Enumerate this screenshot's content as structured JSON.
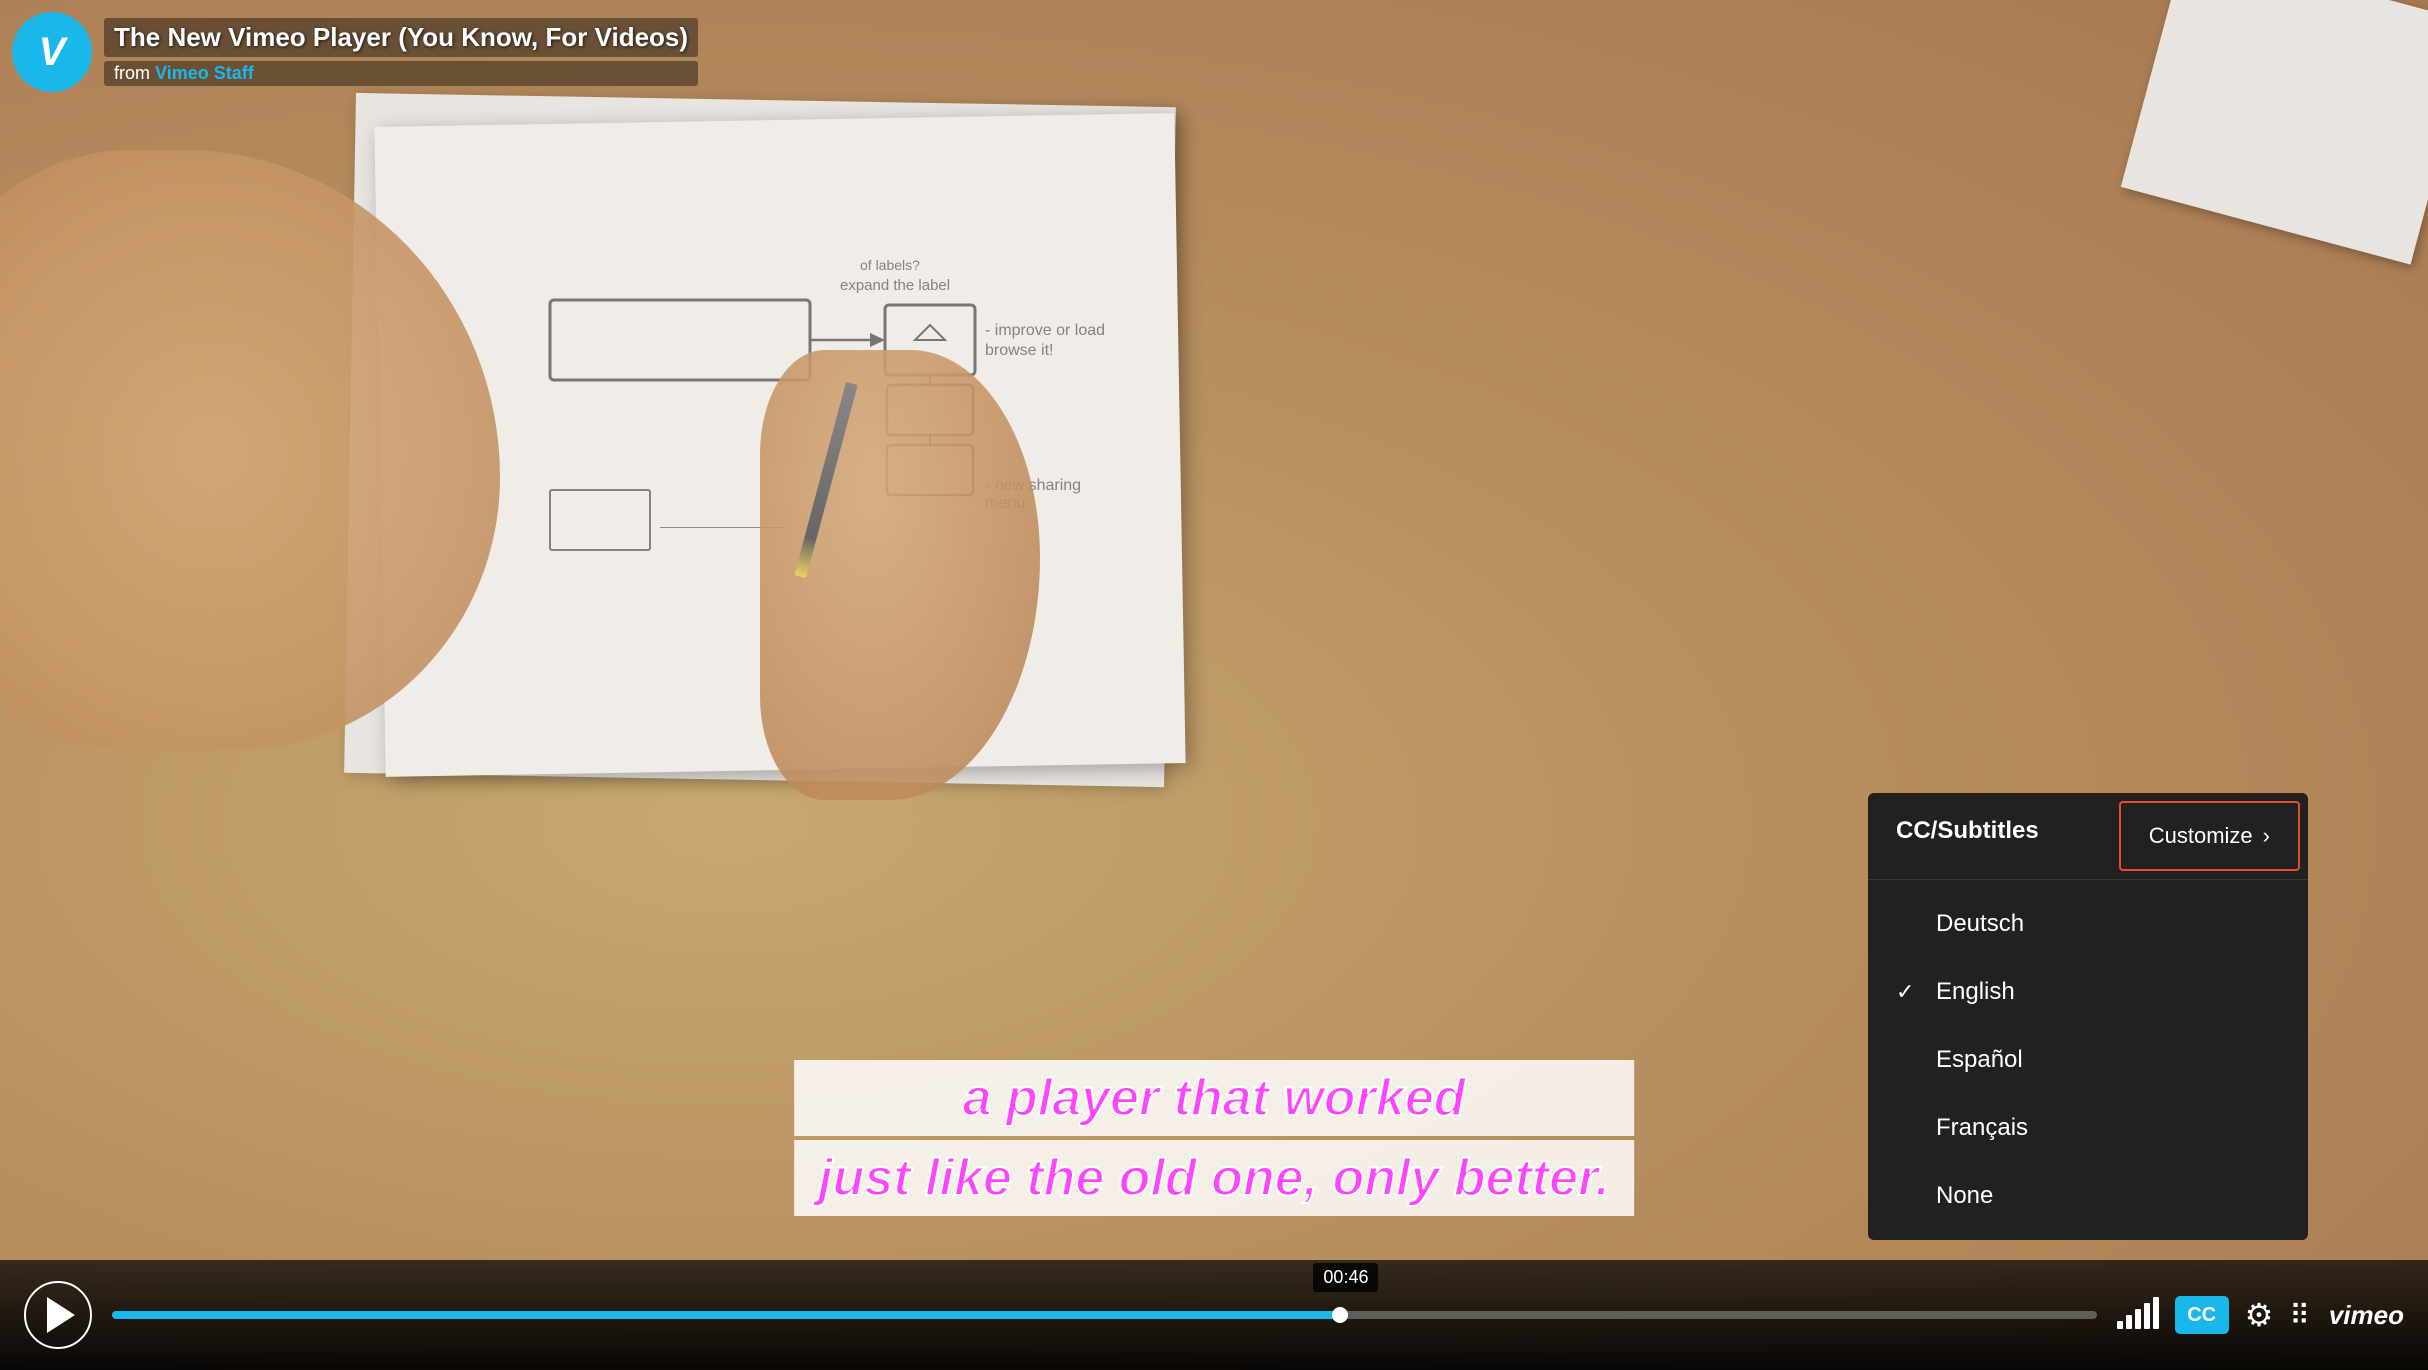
{
  "player": {
    "title": "The New Vimeo Player (You Know, For Videos)",
    "from_label": "from",
    "from_author": "Vimeo Staff",
    "logo_letter": "V"
  },
  "captions": {
    "line1": "a player that worked",
    "line2": "just like the old one, only better."
  },
  "controls": {
    "play_button_label": "Play",
    "time_tooltip": "00:46",
    "progress_percent": 62,
    "cc_label": "CC",
    "gear_symbol": "⚙",
    "dots_symbol": "⠿",
    "vimeo_label": "vimeo",
    "volume_bars": [
      8,
      14,
      20,
      26,
      32
    ]
  },
  "cc_menu": {
    "title": "CC/Subtitles",
    "customize_label": "Customize",
    "items": [
      {
        "label": "Deutsch",
        "selected": false
      },
      {
        "label": "English",
        "selected": true
      },
      {
        "label": "Español",
        "selected": false
      },
      {
        "label": "Français",
        "selected": false
      },
      {
        "label": "None",
        "selected": false
      }
    ]
  },
  "colors": {
    "vimeo_blue": "#1ab7ea",
    "accent_red": "#e05030",
    "caption_color": "#ff44ff"
  }
}
